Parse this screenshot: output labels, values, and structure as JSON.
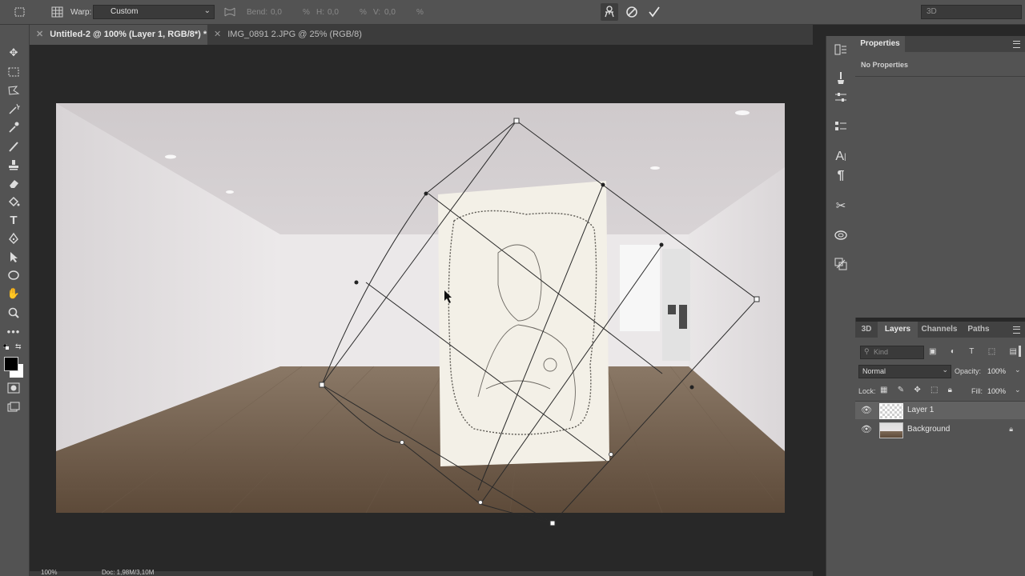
{
  "options_bar": {
    "warp_label": "Warp:",
    "warp_value": "Custom",
    "bend_label": "Bend:",
    "bend_value": "0,0",
    "bend_unit": "%",
    "h_label": "H:",
    "h_value": "0,0",
    "h_unit": "%",
    "v_label": "V:",
    "v_value": "0,0",
    "v_unit": "%",
    "workspace_value": "3D"
  },
  "tabs": [
    {
      "label": "Untitled-2 @ 100% (Layer 1, RGB/8*) *",
      "active": true
    },
    {
      "label": "IMG_0891 2.JPG @ 25% (RGB/8) *",
      "active": false
    }
  ],
  "properties_panel": {
    "title": "Properties",
    "body_text": "No Properties"
  },
  "layers_panel": {
    "tabs": [
      "3D",
      "Layers",
      "Channels",
      "Paths"
    ],
    "selected_tab": "Layers",
    "kind_placeholder": "Kind",
    "blend_mode": "Normal",
    "opacity_label": "Opacity:",
    "opacity_value": "100%",
    "lock_label": "Lock:",
    "fill_label": "Fill:",
    "fill_value": "100%",
    "layers": [
      {
        "name": "Layer 1",
        "selected": true,
        "locked": false
      },
      {
        "name": "Background",
        "selected": false,
        "locked": true
      }
    ]
  },
  "status_bar": {
    "zoom": "100%",
    "doc_info": "Doc: 1,98M/3,10M"
  },
  "colors": {
    "ui_panel": "#535353",
    "ui_dark": "#282828",
    "foreground": "#000000",
    "background": "#ffffff"
  }
}
